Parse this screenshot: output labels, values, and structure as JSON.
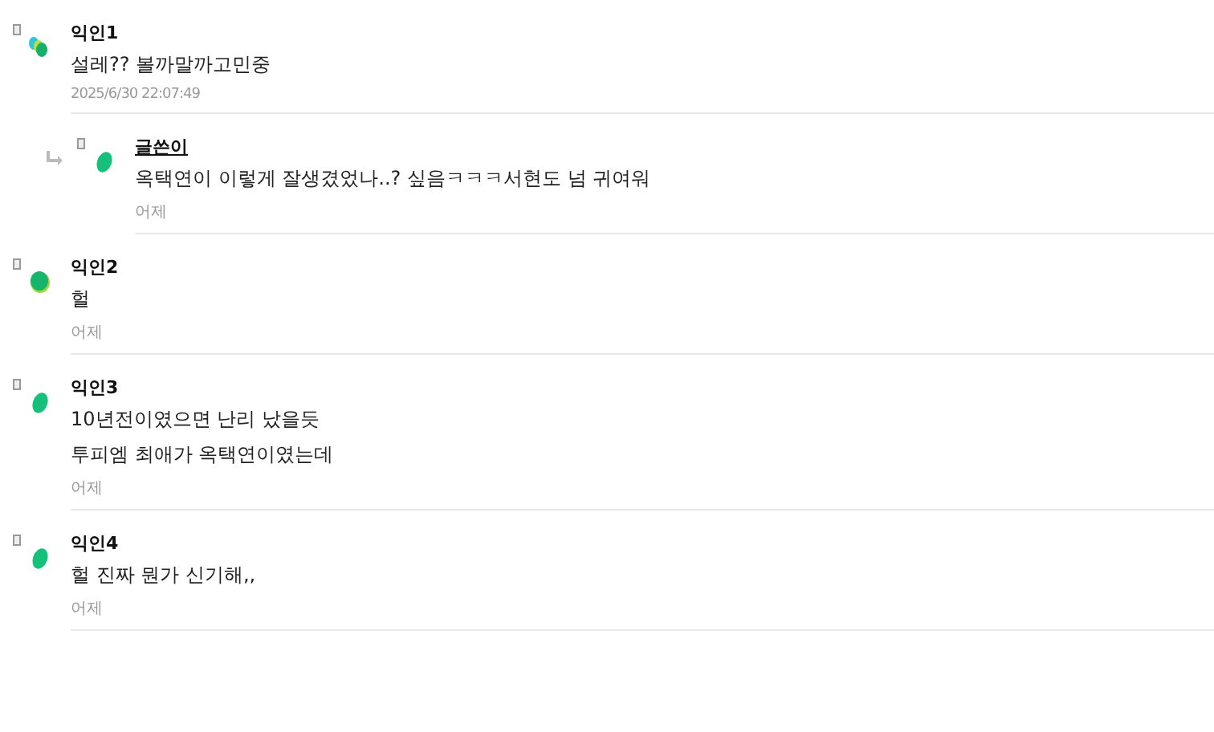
{
  "comments": [
    {
      "name": "익인1",
      "author": false,
      "kind": "multi",
      "lines": [
        "설레?? 볼까말까고민중"
      ],
      "time": "2025/6/30 22:07:49",
      "replies": [
        {
          "name": "글쓴이",
          "author": true,
          "kind": "single",
          "lines": [
            "옥택연이 이렇게 잘생겼었나..? 싶음ㅋㅋㅋ서현도 넘 귀여워"
          ],
          "time": "어제"
        }
      ]
    },
    {
      "name": "익인2",
      "author": false,
      "kind": "round",
      "lines": [
        "헐"
      ],
      "time": "어제"
    },
    {
      "name": "익인3",
      "author": false,
      "kind": "single",
      "lines": [
        "10년전이였으면 난리 났을듯",
        "투피엠 최애가 옥택연이였는데"
      ],
      "time": "어제"
    },
    {
      "name": "익인4",
      "author": false,
      "kind": "single",
      "lines": [
        "헐 진짜 뭔가 신기해,,"
      ],
      "time": "어제"
    }
  ]
}
